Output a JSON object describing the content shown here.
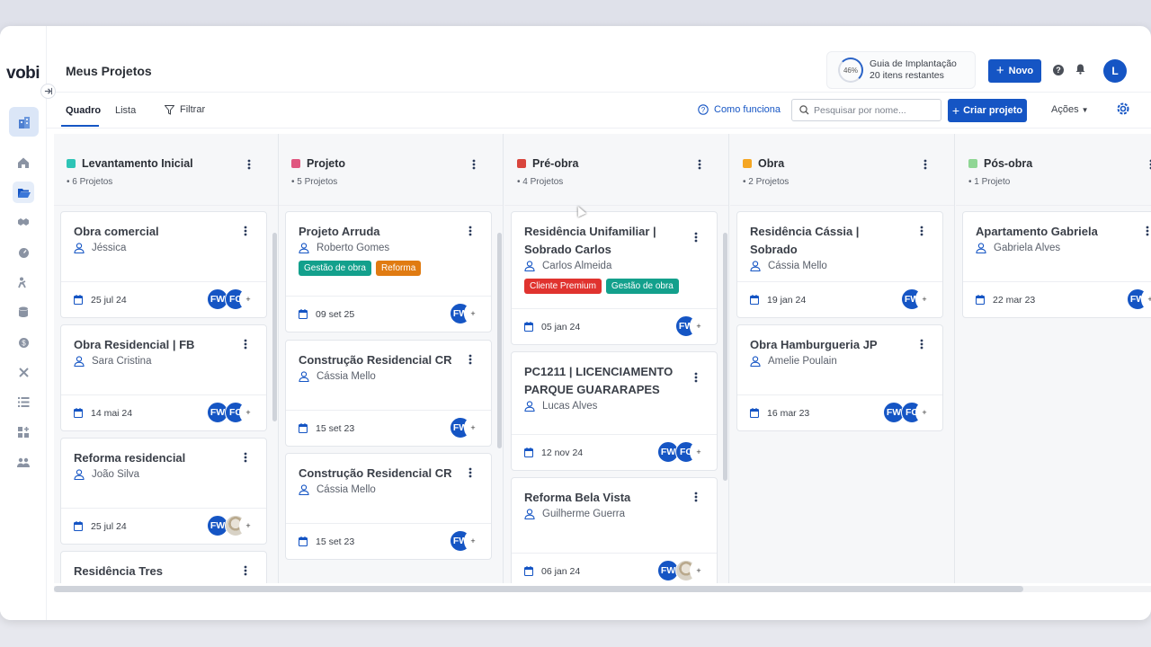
{
  "app": {
    "logo": "vobi",
    "page_title": "Meus Projetos"
  },
  "guide": {
    "percent": "46%",
    "title": "Guia de Implantação",
    "subtitle": "20 itens restantes",
    "progress": 0.46
  },
  "header": {
    "new_label": "Novo",
    "help_label": "?",
    "user_initial": "L"
  },
  "toolbar": {
    "tabs": [
      {
        "label": "Quadro"
      },
      {
        "label": "Lista"
      }
    ],
    "filter_label": "Filtrar",
    "how_label": "Como funciona",
    "search_placeholder": "Pesquisar por nome...",
    "create_label": "Criar projeto",
    "actions_label": "Ações"
  },
  "columns": [
    {
      "title": "Levantamento Inicial",
      "count": "6 Projetos",
      "color": "#2ec4b6",
      "cards": [
        {
          "title": "Obra comercial",
          "person": "Jéssica",
          "date": "25 jul 24",
          "avatars": [
            "FW",
            "FC"
          ]
        },
        {
          "title": "Obra Residencial | FB",
          "person": "Sara Cristina",
          "date": "14 mai 24",
          "avatars": [
            "FW",
            "FC"
          ]
        },
        {
          "title": "Reforma residencial",
          "person": "João Silva",
          "date": "25 jul 24",
          "avatars": [
            "FW",
            ""
          ]
        },
        {
          "title": "Residência Tres"
        }
      ]
    },
    {
      "title": "Projeto",
      "count": "5 Projetos",
      "color": "#e05780",
      "cards": [
        {
          "title": "Projeto Arruda",
          "person": "Roberto Gomes",
          "tags": [
            {
              "label": "Gestão de obra",
              "color": "#13a08c"
            },
            {
              "label": "Reforma",
              "color": "#e07b12"
            }
          ],
          "date": "09 set 25",
          "avatars": [
            "FW"
          ]
        },
        {
          "title": "Construção Residencial CR",
          "person": "Cássia Mello",
          "date": "15 set 23",
          "avatars": [
            "FW"
          ]
        },
        {
          "title": "Construção Residencial CR",
          "person": "Cássia Mello",
          "date": "15 set 23",
          "avatars": [
            "FW"
          ]
        }
      ]
    },
    {
      "title": "Pré-obra",
      "count": "4 Projetos",
      "color": "#d9453d",
      "cards": [
        {
          "title": "Residência Unifamiliar | Sobrado Carlos",
          "person": "Carlos Almeida",
          "tags": [
            {
              "label": "Cliente Premium",
              "color": "#e0332f"
            },
            {
              "label": "Gestão de obra",
              "color": "#13a08c"
            }
          ],
          "date": "05 jan 24",
          "avatars": [
            "FW"
          ]
        },
        {
          "title": "PC1211 | LICENCIAMENTO PARQUE GUARARAPES",
          "person": "Lucas Alves",
          "date": "12 nov 24",
          "avatars": [
            "FW",
            "FC"
          ]
        },
        {
          "title": "Reforma Bela Vista",
          "person": "Guilherme Guerra",
          "date": "06 jan 24",
          "avatars": [
            "FW",
            ""
          ]
        }
      ]
    },
    {
      "title": "Obra",
      "count": "2 Projetos",
      "color": "#f5a623",
      "cards": [
        {
          "title": "Residência Cássia | Sobrado",
          "person": "Cássia Mello",
          "date": "19 jan 24",
          "avatars": [
            "FW"
          ]
        },
        {
          "title": "Obra Hamburgueria JP",
          "person": "Amelie Poulain",
          "date": "16 mar 23",
          "avatars": [
            "FW",
            "FC"
          ]
        }
      ]
    },
    {
      "title": "Pós-obra",
      "count": "1 Projeto",
      "color": "#8fd694",
      "cards": [
        {
          "title": "Apartamento Gabriela",
          "person": "Gabriela Alves",
          "date": "22 mar 23",
          "avatars": [
            "FW"
          ]
        }
      ]
    }
  ],
  "plus": "+"
}
